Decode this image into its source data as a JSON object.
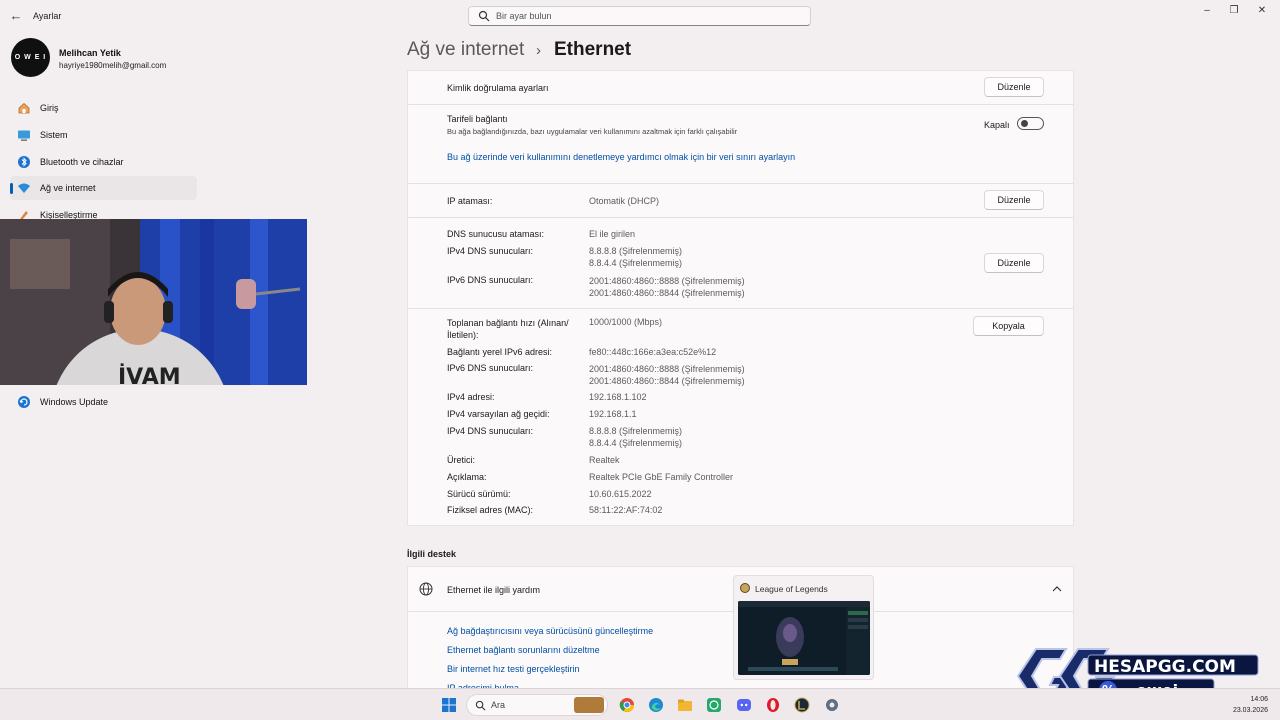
{
  "window": {
    "app_title": "Ayarlar",
    "search_placeholder": "Bir ayar bulun"
  },
  "profile": {
    "avatar_text": "O W E I",
    "name": "Melihcan Yetik",
    "email": "hayriye1980melih@gmail.com"
  },
  "sidebar": {
    "items": [
      {
        "label": "Giriş",
        "icon": "home-icon"
      },
      {
        "label": "Sistem",
        "icon": "monitor-icon"
      },
      {
        "label": "Bluetooth ve cihazlar",
        "icon": "bluetooth-icon"
      },
      {
        "label": "Ağ ve internet",
        "icon": "wifi-icon",
        "active": true
      },
      {
        "label": "Kişiselleştirme",
        "icon": "brush-icon"
      },
      {
        "label": "Windows Update",
        "icon": "update-icon"
      }
    ]
  },
  "breadcrumb": {
    "parent": "Ağ ve internet",
    "separator": "›",
    "current": "Ethernet"
  },
  "auth": {
    "label": "Kimlik doğrulama ayarları",
    "button": "Düzenle"
  },
  "metered": {
    "title": "Tarifeli bağlantı",
    "description": "Bu ağa bağlandığınızda, bazı uygulamalar veri kullanımını azaltmak için farklı çalışabilir",
    "state": "Kapalı",
    "link": "Bu ağ üzerinde veri kullanımını denetlemeye yardımcı olmak için bir veri sınırı ayarlayın"
  },
  "ip_assignment": {
    "label": "IP ataması:",
    "value": "Otomatik (DHCP)",
    "button": "Düzenle"
  },
  "dns": {
    "assign_label": "DNS sunucusu ataması:",
    "assign_value": "El ile girilen",
    "ipv4_label": "IPv4 DNS sunucuları:",
    "ipv4_1": "8.8.8.8 (Şifrelenmemiş)",
    "ipv4_2": "8.8.4.4 (Şifrelenmemiş)",
    "ipv6_label": "IPv6 DNS sunucuları:",
    "ipv6_1": "2001:4860:4860::8888 (Şifrelenmemiş)",
    "ipv6_2": "2001:4860:4860::8844 (Şifrelenmemiş)",
    "button": "Düzenle"
  },
  "properties": {
    "copy_button": "Kopyala",
    "speed_label_1": "Toplanan bağlantı hızı (Alınan/",
    "speed_label_2": "İletilen):",
    "speed_value": "1000/1000 (Mbps)",
    "ipv6_local_label": "Bağlantı yerel IPv6 adresi:",
    "ipv6_local_value": "fe80::448c:166e:a3ea:c52e%12",
    "ipv6_dns_label": "IPv6 DNS sunucuları:",
    "ipv6_dns_1": "2001:4860:4860::8888 (Şifrelenmemiş)",
    "ipv6_dns_2": "2001:4860:4860::8844 (Şifrelenmemiş)",
    "ipv4_label": "IPv4 adresi:",
    "ipv4_value": "192.168.1.102",
    "gateway_label": "IPv4 varsayılan ağ geçidi:",
    "gateway_value": "192.168.1.1",
    "ipv4_dns_label": "IPv4 DNS sunucuları:",
    "ipv4_dns_1": "8.8.8.8 (Şifrelenmemiş)",
    "ipv4_dns_2": "8.8.4.4 (Şifrelenmemiş)",
    "maker_label": "Üretici:",
    "maker_value": "Realtek",
    "desc_label": "Açıklama:",
    "desc_value": "Realtek PCIe GbE Family Controller",
    "driver_label": "Sürücü sürümü:",
    "driver_value": "10.60.615.2022",
    "mac_label": "Fiziksel adres (MAC):",
    "mac_value": "58:11:22:AF:74:02"
  },
  "support": {
    "section_title": "İlgili destek",
    "card_title": "Ethernet ile ilgili yardım",
    "links": [
      "Ağ bağdaştırıcısını veya sürücüsünü güncelleştirme",
      "Ethernet bağlantı sorunlarını düzeltme",
      "Bir internet hız testi gerçekleştirin",
      "IP adresimi bulma"
    ]
  },
  "lol_preview": {
    "title": "League of Legends"
  },
  "brand_logo": {
    "text_top": "HESAPGG.COM",
    "text_bottom": "owei",
    "badge": "%"
  },
  "taskbar": {
    "search_label": "Ara",
    "time": "14:06",
    "date": "23.03.2026"
  },
  "colors": {
    "accent": "#005fb8",
    "link": "#0050a8",
    "background": "#f3eef0"
  }
}
